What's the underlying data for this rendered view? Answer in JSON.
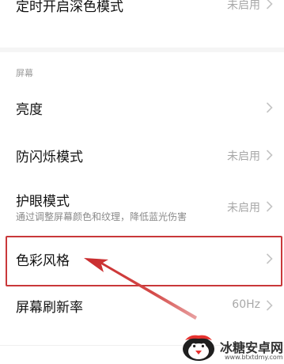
{
  "rows": {
    "scheduled_dark": {
      "title": "定时开启深色模式",
      "value": "未启用"
    },
    "brightness": {
      "title": "亮度"
    },
    "flicker": {
      "title": "防闪烁模式",
      "value": "未启用"
    },
    "eye_care": {
      "title": "护眼模式",
      "subtitle": "通过调整屏幕颜色和纹理，降低蓝光伤害",
      "value": "未启用"
    },
    "color_style": {
      "title": "色彩风格"
    },
    "refresh_rate": {
      "title": "屏幕刷新率",
      "value": "60Hz"
    }
  },
  "section": {
    "screen_label": "屏幕"
  },
  "watermark": {
    "name": "冰糖安卓网",
    "url": "www.btxtdmy.com"
  },
  "colors": {
    "annotation_red": "#c9383a",
    "chevron": "#c4c4c4",
    "secondary_text": "#a8a8a8"
  }
}
